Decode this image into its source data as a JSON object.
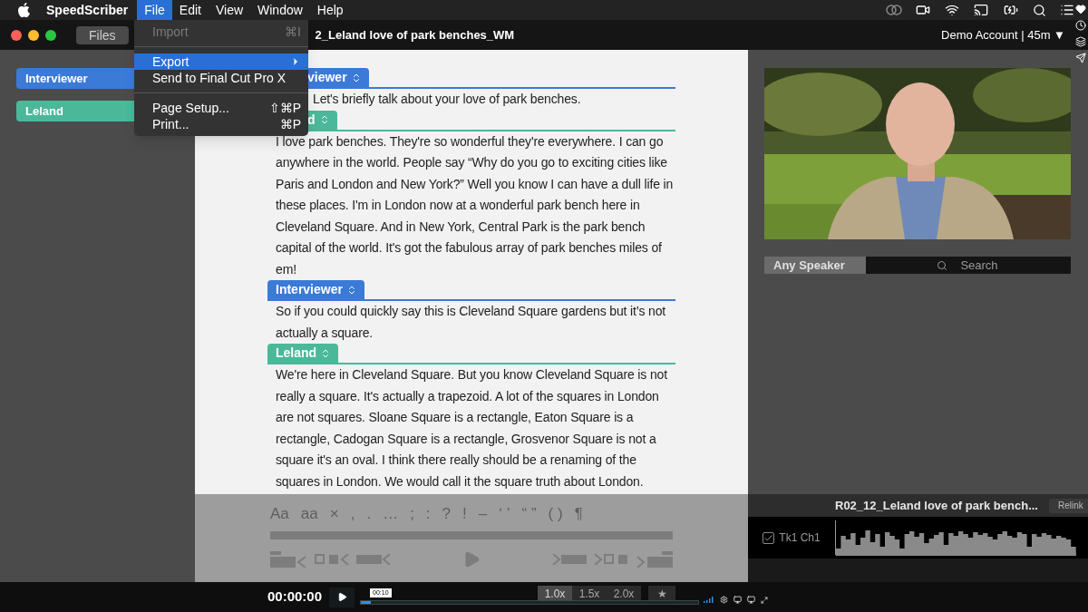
{
  "menu_bar": {
    "app_name": "SpeedScriber",
    "menus": [
      {
        "label": "File",
        "selected": true
      },
      {
        "label": "Edit",
        "selected": false
      },
      {
        "label": "View",
        "selected": false
      },
      {
        "label": "Window",
        "selected": false
      },
      {
        "label": "Help",
        "selected": false
      }
    ]
  },
  "file_menu": {
    "items": [
      {
        "kind": "item",
        "label": "Import",
        "shortcut": "⌘I",
        "disabled": true,
        "selected": false,
        "submenu": false
      },
      {
        "kind": "separator"
      },
      {
        "kind": "item",
        "label": "Export",
        "disabled": false,
        "selected": true,
        "submenu": true
      },
      {
        "kind": "item",
        "label": "Send to Final Cut Pro X",
        "disabled": false,
        "selected": false,
        "submenu": false
      },
      {
        "kind": "separator"
      },
      {
        "kind": "item",
        "label": "Page Setup...",
        "shortcut": "⇧⌘P",
        "disabled": false,
        "selected": false,
        "submenu": false
      },
      {
        "kind": "item",
        "label": "Print...",
        "shortcut": "⌘P",
        "disabled": false,
        "selected": false,
        "submenu": false
      }
    ]
  },
  "title_bar": {
    "files_button": "Files",
    "title": "2_Leland love of park benches_WM",
    "account": "Demo Account | 45m ▼"
  },
  "speakers": [
    {
      "name": "Interviewer",
      "color": "#3b7ad6"
    },
    {
      "name": "Leland",
      "color": "#4bb89a"
    }
  ],
  "transcript": [
    {
      "speaker": "viewer",
      "color": "#3b7ad6",
      "text": "Let's briefly talk about your love of park benches."
    },
    {
      "speaker": "d",
      "color": "#4bb89a",
      "text": "I love park benches. They're so wonderful they're everywhere. I can go anywhere in the world. People say “Why do you go to exciting cities like Paris and London and New York?” Well you know I can have a dull life in these places. I'm in London now at a wonderful park bench here in Cleveland Square. And in New York, Central Park is the park bench capital of the world. It's got the fabulous array of park benches miles of em!"
    },
    {
      "speaker": "Interviewer",
      "color": "#3b7ad6",
      "text": "So if you could quickly say this is Cleveland Square gardens but it’s not actually a square."
    },
    {
      "speaker": "Leland",
      "color": "#4bb89a",
      "text": "We're here in Cleveland Square. But you know Cleveland Square is not really a square. It's actually a trapezoid. A lot of the squares in London are not squares. Sloane Square is a rectangle, Eaton Square is a rectangle, Cadogan Square is a rectangle, Grosvenor Square is not a square it's an oval. I think there really should be a renaming of the squares in London. We would call it the square truth about London."
    }
  ],
  "edit_toolbar": {
    "symbols": [
      "Aa",
      "aa",
      "×",
      ",",
      ".",
      "…",
      ";",
      ":",
      "?",
      "!",
      "–",
      "‘ ’",
      "“ ”",
      "( )",
      "¶"
    ]
  },
  "filter": {
    "speaker_button": "Any Speaker",
    "search": {
      "placeholder": "Search"
    }
  },
  "audio": {
    "file_name": "R02_12_Leland love of park bench...",
    "relink": "Relink",
    "track": {
      "label": "Tk1 Ch1",
      "checked": true
    }
  },
  "player": {
    "time": "00:00:00",
    "position": {
      "level": 0.03,
      "tooltip": "00:10"
    },
    "speeds": [
      {
        "label": "1.0x",
        "selected": true
      },
      {
        "label": "1.5x",
        "selected": false
      },
      {
        "label": "2.0x",
        "selected": false
      }
    ],
    "star": "★"
  }
}
